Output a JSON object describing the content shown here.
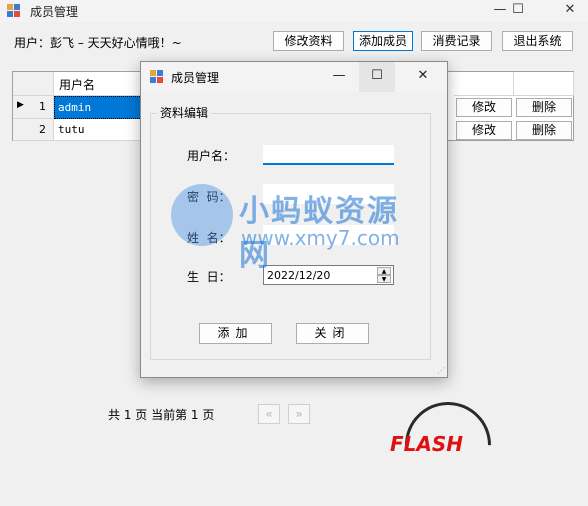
{
  "main_window": {
    "title": "成员管理",
    "min_glyph": "—",
    "max_glyph": "☐",
    "close_glyph": "✕"
  },
  "toolbar": {
    "greeting": "用户：彭飞 – 天天好心情哦！~",
    "edit_profile_label": "修改资料",
    "add_member_label": "添加成员",
    "purchase_records_label": "消费记录",
    "exit_label": "退出系统"
  },
  "grid": {
    "columns": [
      "用户名"
    ],
    "rows": [
      {
        "index": "1",
        "username": "admin",
        "edit_label": "修改",
        "delete_label": "删除",
        "selected": true
      },
      {
        "index": "2",
        "username": "tutu",
        "edit_label": "修改",
        "delete_label": "删除",
        "selected": false
      }
    ]
  },
  "pager": {
    "text": "共 1 页 当前第 1 页",
    "prev_glyph": "«",
    "next_glyph": "»"
  },
  "dialog": {
    "title": "成员管理",
    "min_glyph": "—",
    "max_glyph": "☐",
    "close_glyph": "✕",
    "group_title": "资料编辑",
    "username_label": "用户名：",
    "password_label": "密  码：",
    "name_label": "姓  名：",
    "birthday_label": "生  日：",
    "username_value": "",
    "password_value": "",
    "name_value": "",
    "birthday_value": "2022/12/20",
    "add_button_label": "添加",
    "close_button_label": "关闭"
  },
  "watermark": {
    "title": "小蚂蚁资源网",
    "url": "www.xmy7.com"
  },
  "corner_logo": {
    "text": "FLASH"
  },
  "colors": {
    "accent": "#0078d7",
    "window_bg": "#f0f0f0",
    "watermark_blue": "#2d7dd7"
  }
}
